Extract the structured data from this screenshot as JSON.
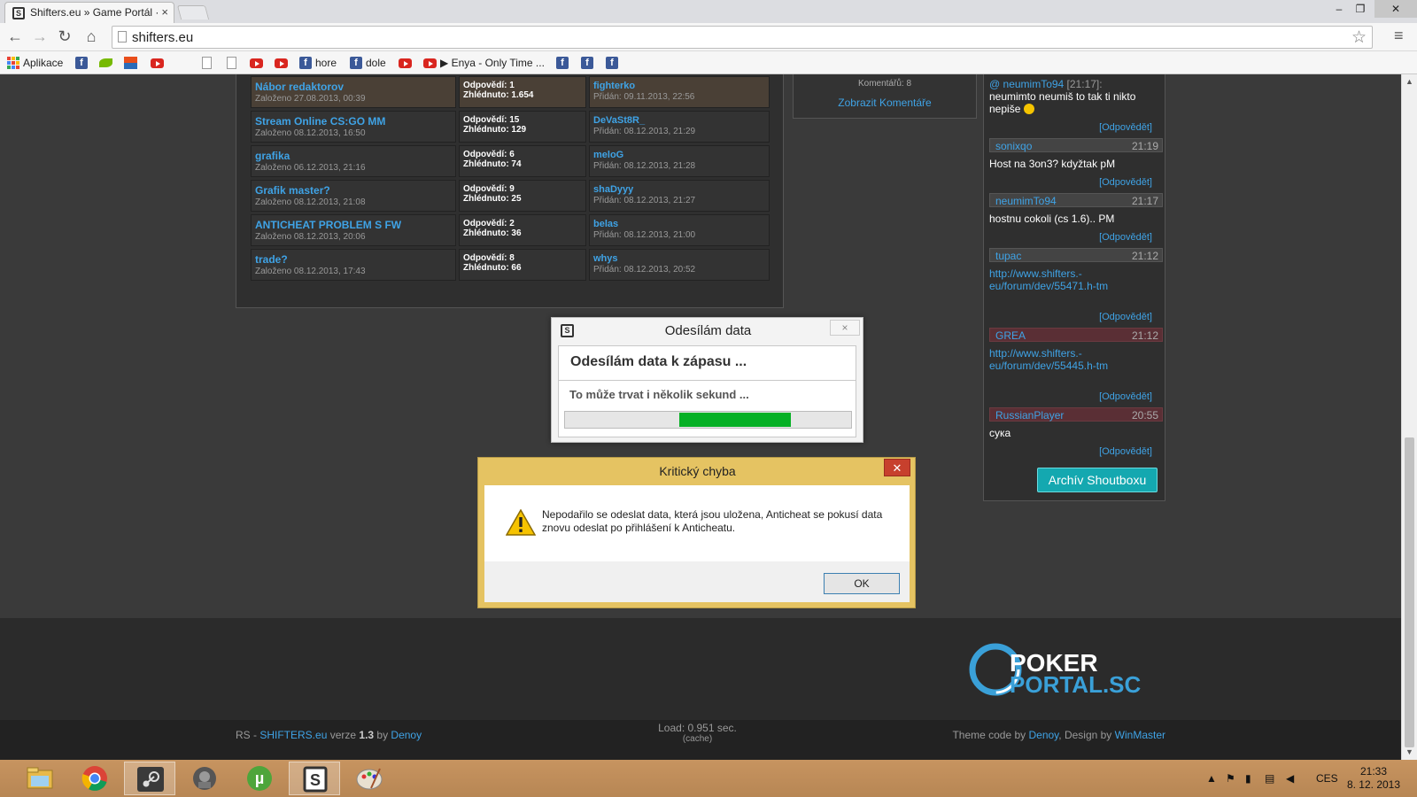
{
  "browser": {
    "tab_title": "Shifters.eu » Game Portál ·",
    "tab_favicon": "S",
    "tab_close": "×",
    "url": "shifters.eu",
    "window_controls": {
      "minimize": "–",
      "maximize": "❐",
      "close": "✕"
    },
    "nav": {
      "back": "←",
      "forward": "→",
      "reload": "↻",
      "home": "⌂",
      "star": "☆",
      "menu": "≡"
    },
    "bookmarks": {
      "apps": "Aplikace",
      "hore": "hore",
      "dole": "dole",
      "enya": "▶ Enya - Only Time ...",
      "fb": "f"
    }
  },
  "forum": {
    "topics": [
      {
        "title": "Nábor redaktorov",
        "created": "Založeno 27.08.2013, 00:39",
        "replies": "Odpovědí: 1",
        "views": "Zhlédnuto: 1.654",
        "last_user": "fighterko",
        "last_time": "Přidán: 09.11.2013, 22:56",
        "highlight": true
      },
      {
        "title": "Stream Online CS:GO MM",
        "created": "Založeno 08.12.2013, 16:50",
        "replies": "Odpovědí: 15",
        "views": "Zhlédnuto: 129",
        "last_user": "DeVaSt8R_",
        "last_time": "Přidán: 08.12.2013, 21:29",
        "highlight": false
      },
      {
        "title": "grafika",
        "created": "Založeno 06.12.2013, 21:16",
        "replies": "Odpovědí: 6",
        "views": "Zhlédnuto: 74",
        "last_user": "meloG",
        "last_time": "Přidán: 08.12.2013, 21:28",
        "highlight": false
      },
      {
        "title": "Grafik master?",
        "created": "Založeno 08.12.2013, 21:08",
        "replies": "Odpovědí: 9",
        "views": "Zhlédnuto: 25",
        "last_user": "shaDyyy",
        "last_time": "Přidán: 08.12.2013, 21:27",
        "highlight": false
      },
      {
        "title": "ANTICHEAT PROBLEM S FW",
        "created": "Založeno 08.12.2013, 20:06",
        "replies": "Odpovědí: 2",
        "views": "Zhlédnuto: 36",
        "last_user": "belas",
        "last_time": "Přidán: 08.12.2013, 21:00",
        "highlight": false
      },
      {
        "title": "trade?",
        "created": "Založeno 08.12.2013, 17:43",
        "replies": "Odpovědí: 8",
        "views": "Zhlédnuto: 66",
        "last_user": "whys",
        "last_time": "Přidán: 08.12.2013, 20:52",
        "highlight": false
      }
    ]
  },
  "comments": {
    "count": "Komentářů: 8",
    "show_link": "Zobrazit Komentáře"
  },
  "shoutbox": {
    "first": {
      "prefix": "@ ",
      "name": "neumimTo94",
      "time": " [21:17]:",
      "text": "neumimto neumiš to tak ti nikto nepiše"
    },
    "reply_label": "[Odpovědět]",
    "messages": [
      {
        "user": "sonixqo",
        "time": "21:19",
        "text": "Host na 3on3? kdyžtak pM",
        "red": false
      },
      {
        "user": "neumimTo94",
        "time": "21:17",
        "text": "hostnu cokoli (cs 1.6).. PM",
        "red": false
      },
      {
        "user": "tupac",
        "time": "21:12",
        "text": "http://www.shifters.-eu/forum/dev/55471.h-tm",
        "red": false
      },
      {
        "user": "GREA",
        "time": "21:12",
        "text": "http://www.shifters.-eu/forum/dev/55445.h-tm",
        "red": true
      },
      {
        "user": "RussianPlayer",
        "time": "20:55",
        "text": "cyка",
        "red": true
      }
    ],
    "archive_button": "Archív Shoutboxu"
  },
  "footer": {
    "logo_line1": "POKER",
    "logo_line2": "PORTAL.SC",
    "left_prefix": "RS - ",
    "left_site": "SHIFTERS.eu",
    "left_mid": " verze ",
    "left_version": "1.3",
    "left_by": " by ",
    "left_author": "Denoy",
    "load": "Load: 0.951 sec.",
    "cache": "(cache)",
    "right_prefix": "Theme code by ",
    "right_author": "Denoy",
    "right_mid": ", Design by ",
    "right_designer": "WinMaster"
  },
  "send_dialog": {
    "title": "Odesílám data",
    "heading": "Odesílám data k zápasu ...",
    "subtext": "To může trvat i několik sekund ...",
    "close": "×",
    "progress_start": 0.4,
    "progress_end": 0.79
  },
  "error_dialog": {
    "title": "Kritický chyba",
    "message": "Nepodařilo se odeslat data, která jsou uložena, Anticheat se pokusí data znovu odeslat po přihlášení k Anticheatu.",
    "ok": "OK",
    "close": "✕"
  },
  "taskbar": {
    "tray_up": "▲",
    "language": "CES",
    "time": "21:33",
    "date": "8. 12. 2013"
  },
  "colors": {
    "link": "#3fa3e6",
    "progress": "#06b025",
    "archive_button": "#14a8b0",
    "error_frame": "#e5c362",
    "taskbar": "#b78654"
  }
}
